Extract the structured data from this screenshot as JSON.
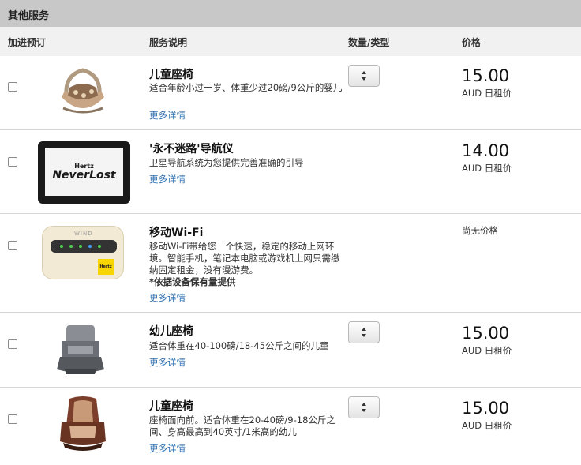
{
  "section_title": "其他服务",
  "headers": {
    "add": "加进预订",
    "description": "服务说明",
    "quantity": "数量/类型",
    "price": "价格"
  },
  "more_details": "更多详情",
  "items": [
    {
      "title": "儿童座椅",
      "description": "适合年龄小过一岁、体重少过20磅/9公斤的婴儿",
      "price": "15.00",
      "unit": "AUD 日租价",
      "icon": "infant-carrier-icon"
    },
    {
      "title": "'永不迷路'导航仪",
      "description": "卫星导航系统为您提供完善准确的引导",
      "price": "14.00",
      "unit": "AUD 日租价",
      "icon": "gps-navigator-icon",
      "brand_top": "Hertz",
      "brand_name": "NeverLost"
    },
    {
      "title": "移动Wi-Fi",
      "description": "移动Wi-Fi带给您一个快速，稳定的移动上网环境。智能手机，笔记本电脑或游戏机上网只需缴纳固定租金，没有漫游费。",
      "note": "*依据设备保有量提供",
      "price_text": "尚无价格",
      "icon": "mobile-wifi-icon",
      "device_brand": "WIND",
      "device_tag": "Hertz"
    },
    {
      "title": "幼儿座椅",
      "description": "适合体重在40-100磅/18-45公斤之间的儿童",
      "price": "15.00",
      "unit": "AUD 日租价",
      "icon": "booster-seat-icon"
    },
    {
      "title": "儿童座椅",
      "description": "座椅面向前。适合体重在20-40磅/9-18公斤之间、身高最高到40英寸/1米高的幼儿",
      "price": "15.00",
      "unit": "AUD 日租价",
      "icon": "child-seat-icon"
    }
  ]
}
